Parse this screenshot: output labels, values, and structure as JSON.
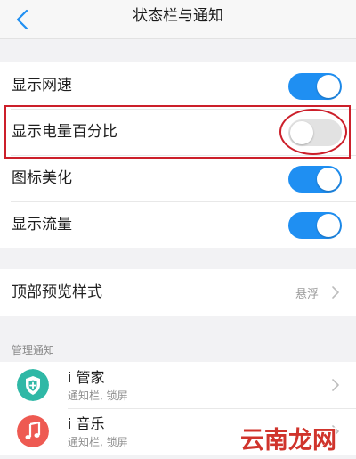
{
  "header": {
    "title": "状态栏与通知"
  },
  "toggles": [
    {
      "label": "显示网速",
      "state": "on"
    },
    {
      "label": "显示电量百分比",
      "state": "off"
    },
    {
      "label": "图标美化",
      "state": "on"
    },
    {
      "label": "显示流量",
      "state": "on"
    }
  ],
  "preview": {
    "label": "顶部预览样式",
    "value": "悬浮"
  },
  "notifications": {
    "section_title": "管理通知",
    "apps": [
      {
        "name": "i 管家",
        "subtitle": "通知栏, 锁屏",
        "icon": "shield-app-icon"
      },
      {
        "name": "i 音乐",
        "subtitle": "通知栏, 锁屏",
        "icon": "music-app-icon"
      }
    ]
  },
  "watermark": "云南龙网",
  "colors": {
    "accent": "#1f8ff2",
    "highlight": "#cc1f2a",
    "watermark": "#d0342c",
    "shield_app": "#2fb8a6",
    "music_app": "#ee5a52"
  }
}
